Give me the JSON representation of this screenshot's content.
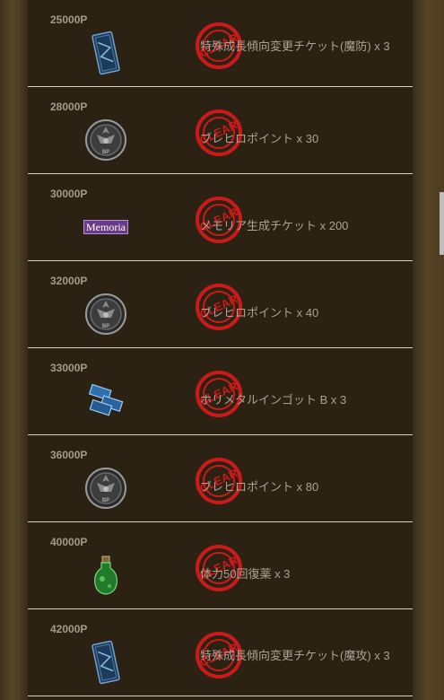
{
  "rewards": [
    {
      "points": "25000P",
      "icon": "blue-ticket-icon",
      "reward": "特殊成長傾向変更チケット(魔防) x 3",
      "status": "CLEAR"
    },
    {
      "points": "28000P",
      "icon": "bp-medal-icon",
      "reward": "ブレヒロポイント x 30",
      "status": "CLEAR"
    },
    {
      "points": "30000P",
      "icon": "memoria-badge-icon",
      "icon_label": "Memoria",
      "reward": "メモリア生成チケット x 200",
      "status": "CLEAR"
    },
    {
      "points": "32000P",
      "icon": "bp-medal-icon",
      "reward": "ブレヒロポイント x 40",
      "status": "CLEAR"
    },
    {
      "points": "33000P",
      "icon": "metal-ingot-icon",
      "reward": "ホリメタルインゴット B x 3",
      "status": "CLEAR"
    },
    {
      "points": "36000P",
      "icon": "bp-medal-icon",
      "reward": "ブレヒロポイント x 80",
      "status": "CLEAR"
    },
    {
      "points": "40000P",
      "icon": "green-potion-icon",
      "reward": "体力50回復薬 x 3",
      "status": "CLEAR"
    },
    {
      "points": "42000P",
      "icon": "blue-ticket-icon",
      "reward": "特殊成長傾向変更チケット(魔攻) x 3",
      "status": "CLEAR"
    }
  ],
  "medal_text": "BP",
  "colors": {
    "stamp": "#cc1a1a",
    "row_bg": "#2b2214",
    "divider": "#d9d3c4",
    "text": "#a9a296"
  }
}
